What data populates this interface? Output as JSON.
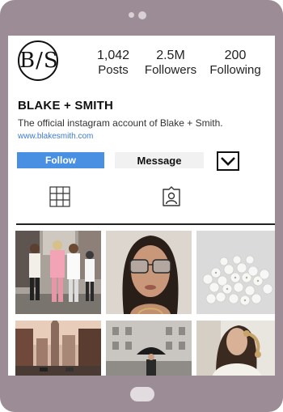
{
  "profile": {
    "avatar_text": "B/S",
    "name": "BLAKE + SMITH",
    "bio": "The official instagram account of Blake + Smith.",
    "link": "www.blakesmith.com"
  },
  "stats": [
    {
      "value": "1,042",
      "label": "Posts"
    },
    {
      "value": "2.5M",
      "label": "Followers"
    },
    {
      "value": "200",
      "label": "Following"
    }
  ],
  "actions": {
    "follow_label": "Follow",
    "message_label": "Message",
    "more_icon": "chevron-down-icon"
  },
  "tabs": [
    {
      "icon": "grid-icon"
    },
    {
      "icon": "tagged-icon"
    }
  ],
  "grid": [
    {
      "subject": "street-style-group-photo"
    },
    {
      "subject": "woman-in-sunglasses-portrait"
    },
    {
      "subject": "white-flowers"
    },
    {
      "subject": "city-skyline-street"
    },
    {
      "subject": "woman-with-umbrella-street"
    },
    {
      "subject": "woman-on-phone"
    }
  ],
  "colors": {
    "device": "#9c8c96",
    "follow_button": "#4a90e2",
    "link": "#3d7bcf",
    "message_button": "#f1f1f1"
  }
}
